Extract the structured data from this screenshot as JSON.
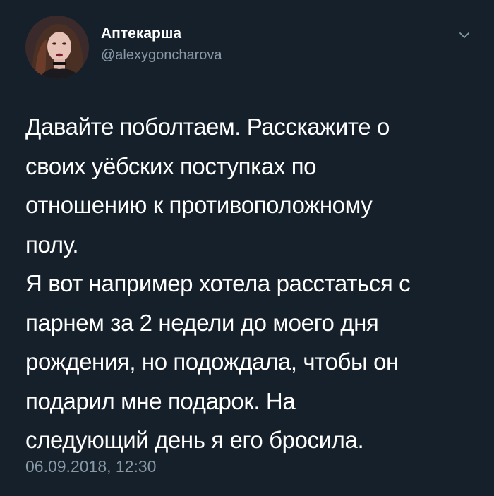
{
  "tweet": {
    "author": {
      "display_name": "Аптекарша",
      "handle": "@alexygoncharova",
      "avatar_icon": "profile-photo"
    },
    "menu_icon": "chevron-down-icon",
    "lines": [
      "Давайте поболтаем. Расскажите о",
      "своих уёбских поступках по",
      "отношению к противоположному",
      "полу.",
      "Я вот например хотела расстаться с",
      "парнем за 2 недели до моего дня",
      "рождения, но подождала, чтобы он",
      "подарил мне подарок. На",
      "следующий день я его бросила."
    ],
    "timestamp": "06.09.2018, 12:30"
  },
  "colors": {
    "background": "#15202b",
    "text_primary": "#ffffff",
    "text_secondary": "#8899a6"
  }
}
